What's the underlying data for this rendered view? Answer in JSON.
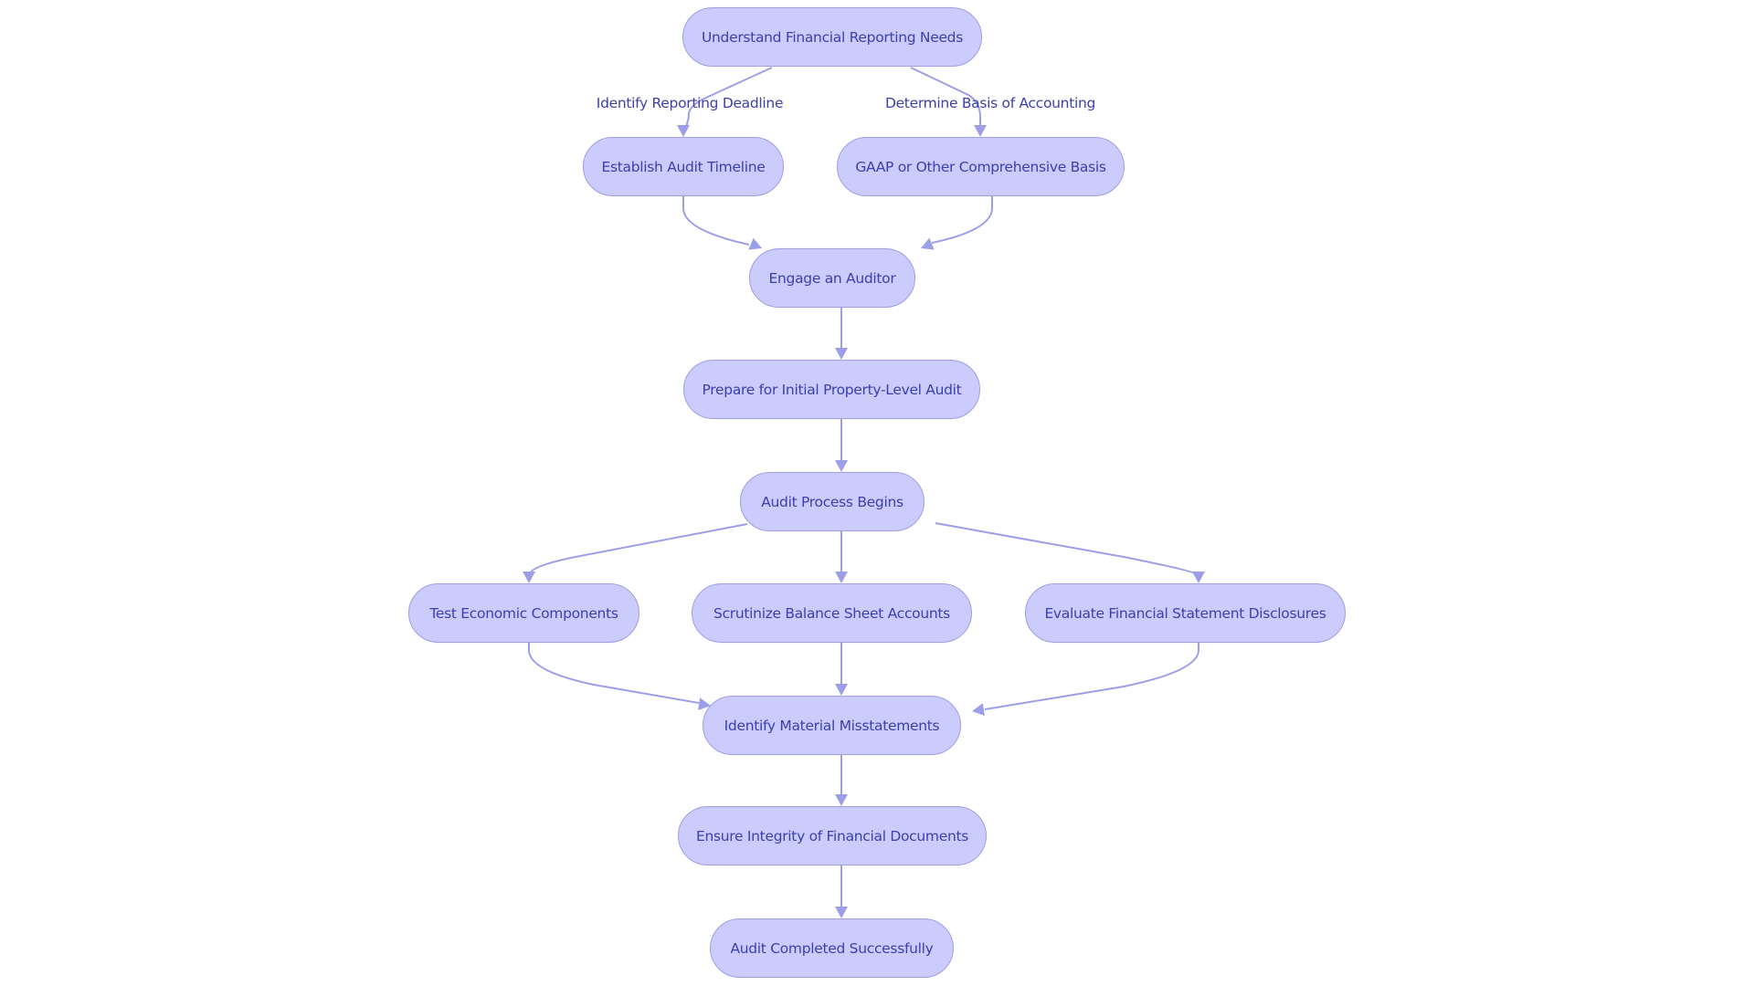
{
  "diagram": {
    "type": "flowchart",
    "direction": "top-to-bottom",
    "colors": {
      "node_fill": "#cbcbfc",
      "node_border": "#9e9ee6",
      "text": "#3c3fae",
      "edge": "#9c9fe8"
    },
    "nodes": [
      {
        "id": "A",
        "label": "Understand Financial Reporting Needs"
      },
      {
        "id": "B",
        "label": "Establish Audit Timeline"
      },
      {
        "id": "C",
        "label": "GAAP or Other Comprehensive Basis"
      },
      {
        "id": "D",
        "label": "Engage an Auditor"
      },
      {
        "id": "E",
        "label": "Prepare for Initial Property-Level Audit"
      },
      {
        "id": "F",
        "label": "Audit Process Begins"
      },
      {
        "id": "G",
        "label": "Test Economic Components"
      },
      {
        "id": "H",
        "label": "Scrutinize Balance Sheet Accounts"
      },
      {
        "id": "I",
        "label": "Evaluate Financial Statement Disclosures"
      },
      {
        "id": "J",
        "label": "Identify Material Misstatements"
      },
      {
        "id": "K",
        "label": "Ensure Integrity of Financial Documents"
      },
      {
        "id": "L",
        "label": "Audit Completed Successfully"
      }
    ],
    "edges": [
      {
        "from": "A",
        "to": "B",
        "label": "Identify Reporting Deadline"
      },
      {
        "from": "A",
        "to": "C",
        "label": "Determine Basis of Accounting"
      },
      {
        "from": "B",
        "to": "D",
        "label": ""
      },
      {
        "from": "C",
        "to": "D",
        "label": ""
      },
      {
        "from": "D",
        "to": "E",
        "label": ""
      },
      {
        "from": "E",
        "to": "F",
        "label": ""
      },
      {
        "from": "F",
        "to": "G",
        "label": ""
      },
      {
        "from": "F",
        "to": "H",
        "label": ""
      },
      {
        "from": "F",
        "to": "I",
        "label": ""
      },
      {
        "from": "G",
        "to": "J",
        "label": ""
      },
      {
        "from": "H",
        "to": "J",
        "label": ""
      },
      {
        "from": "I",
        "to": "J",
        "label": ""
      },
      {
        "from": "J",
        "to": "K",
        "label": ""
      },
      {
        "from": "K",
        "to": "L",
        "label": ""
      }
    ]
  }
}
